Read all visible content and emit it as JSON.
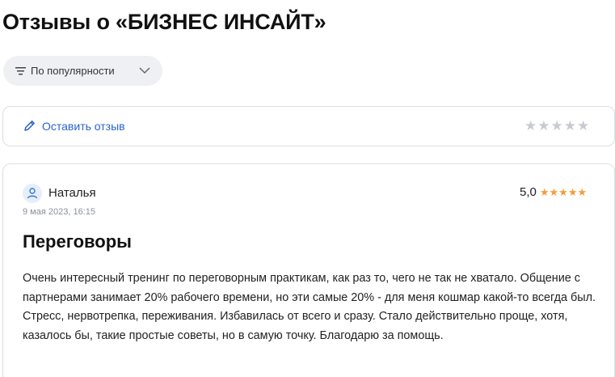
{
  "page": {
    "title": "Отзывы о «БИЗНЕС ИНСАЙТ»"
  },
  "sort": {
    "label": "По популярности",
    "icon": "sort-icon"
  },
  "leave_review": {
    "label": "Оставить отзыв",
    "icon": "pencil-icon",
    "rating_stars": [
      "★",
      "★",
      "★",
      "★",
      "★"
    ]
  },
  "review": {
    "author": "Наталья",
    "date": "9 мая 2023, 16:15",
    "rating_value": "5,0",
    "rating": 5,
    "stars": [
      "★",
      "★",
      "★",
      "★",
      "★"
    ],
    "title": "Переговоры",
    "text": "Очень интересный тренинг по переговорным практикам, как раз то, чего не так не хватало. Общение с партнерами занимает 20% рабочего времени, но эти самые 20% - для меня кошмар какой-то всегда был. Стресс, нервотрепка, переживания. Избавилась от всего и сразу. Стало действительно проще, хотя, казалось бы, такие простые советы, но в самую точку. Благодарю за помощь."
  },
  "colors": {
    "link": "#2a64c8",
    "star_filled": "#f29d38",
    "star_empty": "#c7cbd1",
    "pill_bg": "#eef0f3"
  }
}
